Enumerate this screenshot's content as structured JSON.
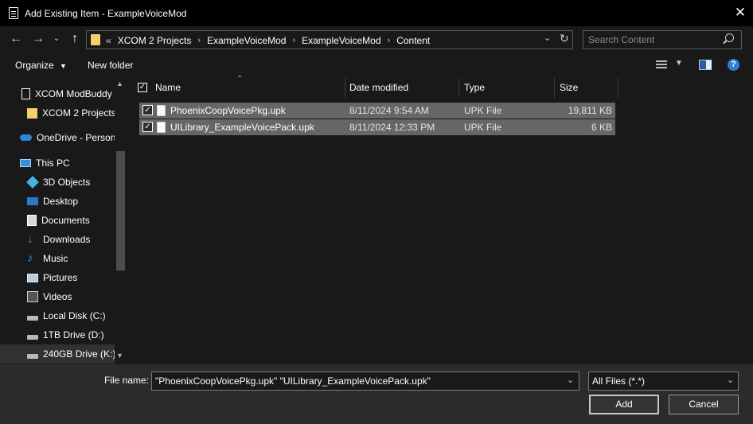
{
  "window": {
    "title": "Add Existing Item - ExampleVoiceMod"
  },
  "nav": {
    "crumb_prefix": "«",
    "breadcrumbs": [
      "XCOM 2 Projects",
      "ExampleVoiceMod",
      "ExampleVoiceMod",
      "Content"
    ]
  },
  "search": {
    "placeholder": "Search Content"
  },
  "toolbar": {
    "organize": "Organize",
    "new_folder": "New folder"
  },
  "sidebar": {
    "items": [
      {
        "label": "XCOM ModBuddy",
        "icon": "document-icon"
      },
      {
        "label": "XCOM 2 Projects",
        "icon": "folder-icon"
      },
      {
        "label": "OneDrive - Personal",
        "icon": "cloud-icon"
      },
      {
        "label": "This PC",
        "icon": "computer-icon"
      },
      {
        "label": "3D Objects",
        "icon": "cube-icon"
      },
      {
        "label": "Desktop",
        "icon": "desktop-icon"
      },
      {
        "label": "Documents",
        "icon": "documents-icon"
      },
      {
        "label": "Downloads",
        "icon": "download-icon"
      },
      {
        "label": "Music",
        "icon": "music-icon"
      },
      {
        "label": "Pictures",
        "icon": "pictures-icon"
      },
      {
        "label": "Videos",
        "icon": "videos-icon"
      },
      {
        "label": "Local Disk (C:)",
        "icon": "disk-icon"
      },
      {
        "label": "1TB Drive (D:)",
        "icon": "disk-icon"
      },
      {
        "label": "240GB Drive (K:)",
        "icon": "disk-icon"
      }
    ]
  },
  "columns": {
    "name": "Name",
    "date": "Date modified",
    "type": "Type",
    "size": "Size"
  },
  "files": [
    {
      "name": "PhoenixCoopVoicePkg.upk",
      "date": "8/11/2024 9:54 AM",
      "type": "UPK File",
      "size": "19,811 KB",
      "checked": true
    },
    {
      "name": "UILibrary_ExampleVoicePack.upk",
      "date": "8/11/2024 12:33 PM",
      "type": "UPK File",
      "size": "6 KB",
      "checked": true
    }
  ],
  "bottom": {
    "file_name_label": "File name:",
    "file_name_value": "\"PhoenixCoopVoicePkg.upk\" \"UILibrary_ExampleVoicePack.upk\"",
    "filter": "All Files (*.*)",
    "add": "Add",
    "cancel": "Cancel"
  },
  "colors": {
    "accent": "#2f7fd6",
    "folder": "#f4cf6b",
    "selection": "#666666",
    "background": "#191919"
  }
}
